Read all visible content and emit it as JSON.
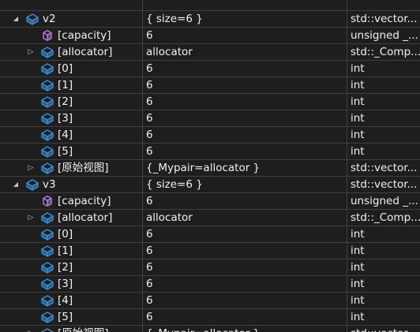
{
  "rows": [
    {
      "name": "",
      "value": "",
      "type": "",
      "depth": 0,
      "expander": "none",
      "icon": "",
      "partial": true
    },
    {
      "name": "v2",
      "value": "{ size=6 }",
      "type": "std::vector...",
      "depth": 0,
      "expander": "expanded",
      "icon": "field-icon"
    },
    {
      "name": "[capacity]",
      "value": "6",
      "type": "unsigned _...",
      "depth": 1,
      "expander": "none",
      "icon": "property-icon"
    },
    {
      "name": "[allocator]",
      "value": "allocator",
      "type": "std::_Comp...",
      "depth": 1,
      "expander": "collapsed",
      "icon": "field-icon"
    },
    {
      "name": "[0]",
      "value": "6",
      "type": "int",
      "depth": 1,
      "expander": "none",
      "icon": "field-icon"
    },
    {
      "name": "[1]",
      "value": "6",
      "type": "int",
      "depth": 1,
      "expander": "none",
      "icon": "field-icon"
    },
    {
      "name": "[2]",
      "value": "6",
      "type": "int",
      "depth": 1,
      "expander": "none",
      "icon": "field-icon"
    },
    {
      "name": "[3]",
      "value": "6",
      "type": "int",
      "depth": 1,
      "expander": "none",
      "icon": "field-icon"
    },
    {
      "name": "[4]",
      "value": "6",
      "type": "int",
      "depth": 1,
      "expander": "none",
      "icon": "field-icon"
    },
    {
      "name": "[5]",
      "value": "6",
      "type": "int",
      "depth": 1,
      "expander": "none",
      "icon": "field-icon"
    },
    {
      "name": "[原始视图]",
      "value": "{_Mypair=allocator }",
      "type": "std::vector...",
      "depth": 1,
      "expander": "collapsed",
      "icon": "field-icon"
    },
    {
      "name": "v3",
      "value": "{ size=6 }",
      "type": "std::vector...",
      "depth": 0,
      "expander": "expanded",
      "icon": "field-icon"
    },
    {
      "name": "[capacity]",
      "value": "6",
      "type": "unsigned _...",
      "depth": 1,
      "expander": "none",
      "icon": "property-icon"
    },
    {
      "name": "[allocator]",
      "value": "allocator",
      "type": "std::_Comp...",
      "depth": 1,
      "expander": "collapsed",
      "icon": "field-icon"
    },
    {
      "name": "[0]",
      "value": "6",
      "type": "int",
      "depth": 1,
      "expander": "none",
      "icon": "field-icon"
    },
    {
      "name": "[1]",
      "value": "6",
      "type": "int",
      "depth": 1,
      "expander": "none",
      "icon": "field-icon"
    },
    {
      "name": "[2]",
      "value": "6",
      "type": "int",
      "depth": 1,
      "expander": "none",
      "icon": "field-icon"
    },
    {
      "name": "[3]",
      "value": "6",
      "type": "int",
      "depth": 1,
      "expander": "none",
      "icon": "field-icon"
    },
    {
      "name": "[4]",
      "value": "6",
      "type": "int",
      "depth": 1,
      "expander": "none",
      "icon": "field-icon"
    },
    {
      "name": "[5]",
      "value": "6",
      "type": "int",
      "depth": 1,
      "expander": "none",
      "icon": "field-icon"
    },
    {
      "name": "[原始视图]",
      "value": "{_Mypair=allocator }",
      "type": "std::vector...",
      "depth": 1,
      "expander": "collapsed",
      "icon": "field-icon"
    }
  ],
  "colors": {
    "background": "#1e1e1e",
    "gridline": "#3f3f46",
    "text": "#f1f1f1",
    "field_icon": "#3b8fd6",
    "property_icon": "#b180d7"
  }
}
